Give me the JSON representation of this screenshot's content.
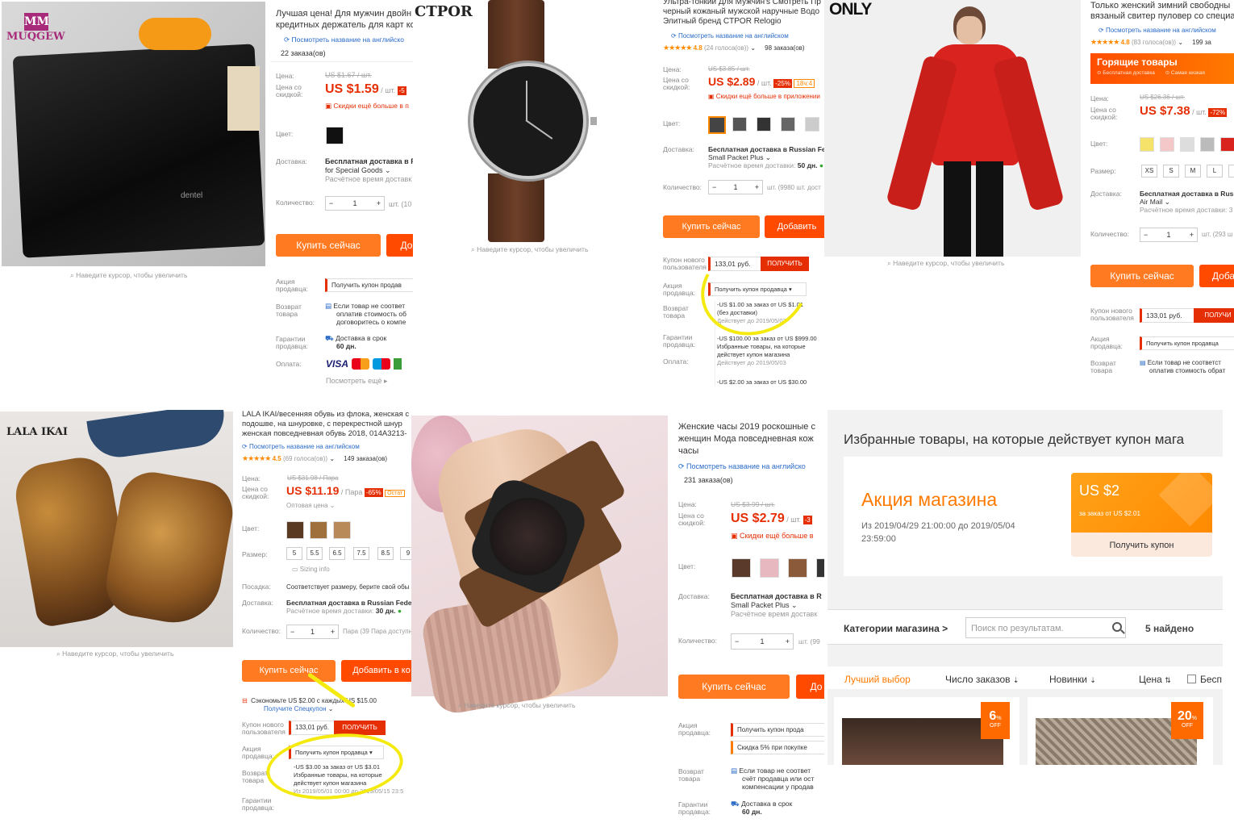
{
  "p1": {
    "brand_logo": "MUQGEW",
    "title_lines": [
      "Лучшая цена! Для мужчин двойн",
      "кредитных держатель для карт ко"
    ],
    "translate_link": "Посмотреть название на английско",
    "orders": "22 заказа(ов)",
    "price_label": "Цена:",
    "old_price": "US $1.67 / шт.",
    "disc_label": "Цена со скидкой:",
    "new_price": "US $1.59",
    "unit": "/ шт.",
    "disc_badge": "-5",
    "app_note": "Скидки ещё больше в п",
    "color_label": "Цвет:",
    "delivery_label": "Доставка:",
    "delivery": "Бесплатная доставка в R",
    "delivery2": "for Special Goods",
    "delivery_time": "Расчётное время доставк",
    "qty_label": "Количество:",
    "qty_minus": "−",
    "qty": "1",
    "qty_plus": "+",
    "qty_note": "шт. (10",
    "buy": "Купить сейчас",
    "add": "До",
    "zoom": "Наведите курсор, чтобы увеличить",
    "promo_label": "Акция продавца:",
    "promo": "Получить купон продав",
    "return_label": "Возврат товара",
    "return_text": [
      "Если товар не соответ",
      "оплатив стоимость об",
      "договоритесь о компе"
    ],
    "guarantee_label": "Гарантии продавца:",
    "guarantee": "Доставка в срок",
    "guarantee_days": "60 дн.",
    "pay_label": "Оплата:",
    "pay_visa": "VISA",
    "pay_more": "Посмотреть ещё"
  },
  "p2": {
    "brand_logo": "CTPOR",
    "zoom": "Наведите курсор, чтобы увеличить"
  },
  "p3": {
    "title_lines": [
      "Ультра-тонкий Для Мужчин's Смотреть Пр",
      "черный кожаный мужской наручные Водо",
      "Элитный бренд CTPOR Relogio"
    ],
    "translate_link": "Посмотреть название на английском",
    "stars": "★★★★★",
    "rating": "4.8",
    "votes": "(24 голоса(ов))",
    "orders": "98 заказа(ов)",
    "price_label": "Цена:",
    "old_price": "US $3.85 / шт.",
    "disc_label": "Цена со скидкой:",
    "new_price": "US $2.89",
    "unit": "/ шт.",
    "disc_badge": "-25%",
    "days": "18ч:4",
    "app_note": "Скидки ещё больше в приложении",
    "color_label": "Цвет:",
    "delivery_label": "Доставка:",
    "delivery": "Бесплатная доставка в Russian Fed",
    "delivery2": "Small Packet Plus",
    "delivery_time": "Расчётное время доставки:",
    "delivery_days": "50 дн.",
    "qty_label": "Количество:",
    "qty_minus": "−",
    "qty": "1",
    "qty_plus": "+",
    "qty_note": "шт. (9980 шт. дост",
    "buy": "Купить сейчас",
    "add": "Добавить",
    "newuser_label": "Купон нового пользователя",
    "newuser_amount": "133,01 руб.",
    "newuser_btn": "ПОЛУЧИТЬ",
    "promo_label": "Акция продавца:",
    "promo": "Получить купон продавца",
    "coupons": [
      {
        "line1": "-US $1.00 за заказ от US $1.01",
        "line2": "(без доставки)",
        "line3": "Действует до 2019/05/03"
      },
      {
        "line1": "-US $100.00 за заказ от US $999.00",
        "line2": "Избранные товары, на которые",
        "line3": "действует купон магазина",
        "line4": "Действует до 2019/05/03"
      },
      {
        "line1": "-US $2.00 за заказ от US $30.00"
      }
    ],
    "return_label": "Возврат товара",
    "guarantee_label": "Гарантии продавца:",
    "pay_label": "Оплата:"
  },
  "p4": {
    "brand_logo": "ONLY",
    "zoom": "Наведите курсор, чтобы увеличить"
  },
  "p5": {
    "title_lines": [
      "Только женский зимний свободны",
      "вязаный свитер пуловер со специа"
    ],
    "translate_link": "Посмотреть название на английском",
    "stars": "★★★★★",
    "rating": "4.8",
    "votes": "(83 голоса(ов))",
    "orders": "199 за",
    "hot_title": "Горящие товары",
    "hot_sub": "Бесплатная доставка",
    "hot_sub2": "Самая низкая",
    "price_label": "Цена:",
    "old_price": "US $26.36 / шт.",
    "disc_label": "Цена со скидкой:",
    "new_price": "US $7.38",
    "unit": "/ шт.",
    "disc_badge": "-72%",
    "color_label": "Цвет:",
    "size_label": "Размер:",
    "sizes": [
      "XS",
      "S",
      "M",
      "L",
      "X"
    ],
    "delivery_label": "Доставка:",
    "delivery": "Бесплатная доставка в Rus",
    "delivery2": "Air Mail",
    "delivery_time": "Расчётное время доставки: 3",
    "qty_label": "Количество:",
    "qty_minus": "−",
    "qty": "1",
    "qty_plus": "+",
    "qty_note": "шт. (293 ш",
    "buy": "Купить сейчас",
    "add": "Доба",
    "newuser_label": "Купон нового пользователя",
    "newuser_amount": "133,01 руб.",
    "newuser_btn": "ПОЛУЧИ",
    "promo_label": "Акция продавца:",
    "promo": "Получить купон продавца",
    "return_label": "Возврат товара",
    "return_text": [
      "Если товар не соответст",
      "оплатив стоимость обрат"
    ]
  },
  "p6": {
    "brand_logo": "LALA IKAI",
    "zoom": "Наведите курсор, чтобы увеличить",
    "title_lines": [
      "LALA IKAI/весенняя обувь из флока, женская с",
      "подошве, на шнуровке, с перекрестной шнур",
      "женская повседневная обувь 2018, 014A3213-"
    ],
    "translate_link": "Посмотреть название на английском",
    "stars": "★★★★★",
    "rating": "4.5",
    "votes": "(69 голоса(ов))",
    "orders": "149 заказа(ов)",
    "price_label": "Цена:",
    "old_price": "US $31.98 / Пара",
    "disc_label": "Цена со скидкой:",
    "new_price": "US $11.19",
    "unit": "/ Пара",
    "disc_badge": "-65%",
    "stock_badge": "Остат",
    "wholesale": "Оптовая цена",
    "color_label": "Цвет:",
    "size_label": "Размер:",
    "sizes": [
      "5",
      "5.5",
      "6.5",
      "7.5",
      "8.5",
      "9"
    ],
    "sizing": "Sizing info",
    "fit_label": "Посадка:",
    "fit": "Соответствует размеру, берите свой обы",
    "delivery_label": "Доставка:",
    "delivery": "Бесплатная доставка в Russian Federat",
    "delivery_time": "Расчётное время доставки:",
    "delivery_days": "30 дн.",
    "qty_label": "Количество:",
    "qty_minus": "−",
    "qty": "1",
    "qty_plus": "+",
    "qty_note": "Пара (39 Пара доступн",
    "buy": "Купить сейчас",
    "add": "Добавить в ко",
    "save_line": "Сэкономьте US $2.00 с каждых US $15.00",
    "save_link": "Получите Спецкупон",
    "newuser_label": "Купон нового пользователя",
    "newuser_amount": "133,01 руб.",
    "newuser_btn": "ПОЛУЧИТЬ",
    "promo_label": "Акция продавца:",
    "promo": "Получить купон продавца",
    "coupon": {
      "line1": "-US $3.00 за заказ от US $3.01",
      "line2": "Избранные товары, на которые",
      "line3": "действует купон магазина",
      "line4": "Из 2019/05/01 00:00 до 2019/05/15 23:5"
    },
    "return_label": "Возврат товара",
    "guarantee_label": "Гарантии продавца:"
  },
  "p7": {
    "zoom": "Наведите курсор, чтобы увеличить",
    "title_lines": [
      "Женские часы 2019 роскошные с",
      "женщин Мода повседневная кож",
      "часы"
    ],
    "translate_link": "Посмотреть название на английско",
    "orders": "231 заказа(ов)",
    "price_label": "Цена:",
    "old_price": "US $3.99 / шт.",
    "disc_label": "Цена со скидкой:",
    "new_price": "US $2.79",
    "unit": "/ шт.",
    "disc_badge": "-3",
    "app_note": "Скидки ещё больше в",
    "color_label": "Цвет:",
    "delivery_label": "Доставка:",
    "delivery": "Бесплатная доставка в R",
    "delivery2": "Small Packet Plus",
    "delivery_time": "Расчётное время доставк",
    "qty_label": "Количество:",
    "qty_minus": "−",
    "qty": "1",
    "qty_plus": "+",
    "qty_note": "шт. (99",
    "buy": "Купить сейчас",
    "add": "До",
    "promo_label": "Акция продавца:",
    "promo": "Получить купон прода",
    "promo2": "Скидка 5% при покупке",
    "return_label": "Возврат товара",
    "return_text": [
      "Если товар не соответ",
      "счёт продавца или ост",
      "компенсации у продав"
    ],
    "guarantee_label": "Гарантии продавца:",
    "guarantee": "Доставка в срок",
    "guarantee_days": "60 дн."
  },
  "p8": {
    "heading": "Избранные товары, на которые действует купон мага",
    "promo_title": "Акция магазина",
    "promo_period": "Из 2019/04/29 21:00:00 до 2019/05/04",
    "promo_period2": "23:59:00",
    "coupon_value": "US $2",
    "coupon_cond": "за заказ от US $2.01",
    "coupon_btn": "Получить купон",
    "categories": "Категории магазина >",
    "search_placeholder": "Поиск по результатам.",
    "found": "5 найдено",
    "sort": [
      "Лучший выбор",
      "Число заказов",
      "Новинки",
      "Цена"
    ],
    "free_ship": "Бесп",
    "badges": [
      {
        "pct": "6",
        "off": "OFF"
      },
      {
        "pct": "20",
        "off": "OFF"
      }
    ]
  }
}
